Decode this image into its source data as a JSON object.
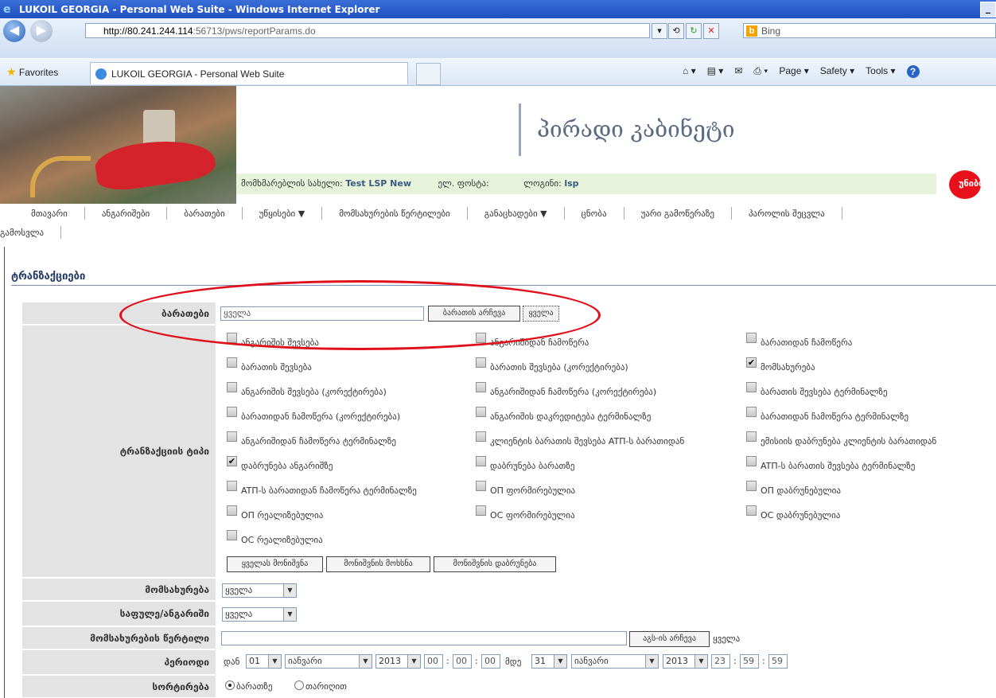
{
  "window": {
    "title": "LUKOIL GEORGIA - Personal Web Suite - Windows Internet Explorer",
    "minimize": "_"
  },
  "address": {
    "url_host": "http://80.241.244.114",
    "url_path": ":56713/pws/reportParams.do",
    "search_text": "Bing"
  },
  "favorites": {
    "label": "Favorites",
    "tab_title": "LUKOIL GEORGIA - Personal Web Suite"
  },
  "commands": {
    "page": "Page ▾",
    "safety": "Safety ▾",
    "tools": "Tools ▾",
    "help": "?"
  },
  "header": {
    "title": "პირადი კაბინეტი",
    "user_label": "მომხმარებლის სახელი:",
    "user_value": "Test LSP New",
    "email_label": "ელ. ფოსტა:",
    "login_label": "ლოგინი:",
    "login_value": "lsp",
    "brand": "უნიბრე"
  },
  "menu": {
    "row1": [
      "მთავარი",
      "ანგარიშები",
      "ბარათები",
      "უწყისები ▼",
      "მომსახურების წერტილები",
      "განაცხადები ▼",
      "ცნობა",
      "უარი გამოწერაზე",
      "პაროლის შეცვლა"
    ],
    "row2": [
      "გამოსვლა"
    ]
  },
  "section_title": "ტრანზაქციები",
  "cards": {
    "label": "ბარათები",
    "value": "ყველა",
    "choose_button": "ბარათის არჩევა",
    "all_button": "ყველა"
  },
  "tx_type": {
    "label": "ტრანზაქციის ტიპი",
    "col1": [
      {
        "label": "ანგარიშის შევსება",
        "checked": false
      },
      {
        "label": "ბარათის შევსება",
        "checked": false
      },
      {
        "label": "ანგარიშის შევსება (კორექტირება)",
        "checked": false
      },
      {
        "label": "ბარათიდან ჩამოწერა (კორექტირება)",
        "checked": false
      },
      {
        "label": "ანგარიშიდან ჩამოწერა ტერმინალზე",
        "checked": false
      },
      {
        "label": "დაბრუნება ანგარიშზე",
        "checked": true
      },
      {
        "label": "ATП-ს ბარათიდან ჩამოწერა ტერმინალზე",
        "checked": false
      },
      {
        "label": "ОП რეალიზებულია",
        "checked": false
      },
      {
        "label": "ОС რეალიზებულია",
        "checked": false
      }
    ],
    "col2": [
      {
        "label": "ანგარიშიდან ჩამოწერა",
        "checked": false
      },
      {
        "label": "ბარათის შევსება (კორექტირება)",
        "checked": false
      },
      {
        "label": "ანგარიშიდან ჩამოწერა (კორექტირება)",
        "checked": false
      },
      {
        "label": "ანგარიშის დაკრედიტება ტერმინალზე",
        "checked": false
      },
      {
        "label": "კლიენტის ბარათის შევსება ATП-ს ბარათიდან",
        "checked": false
      },
      {
        "label": "დაბრუნება ბარათზე",
        "checked": false
      },
      {
        "label": "ОП ფორმირებულია",
        "checked": false
      },
      {
        "label": "ОС ფორმირებულია",
        "checked": false
      }
    ],
    "col3": [
      {
        "label": "ბარათიდან ჩამოწერა",
        "checked": false
      },
      {
        "label": "მომსახურება",
        "checked": true
      },
      {
        "label": "ბარათის შევსება ტერმინალზე",
        "checked": false
      },
      {
        "label": "ბარათიდან ჩამოწერა ტერმინალზე",
        "checked": false
      },
      {
        "label": "ემისიის დაბრუნება კლიენტის ბარათიდან",
        "checked": false
      },
      {
        "label": "ATП-ს ბარათის შევსება ტერმინალზე",
        "checked": false
      },
      {
        "label": "ОП დაბრუნებულია",
        "checked": false
      },
      {
        "label": "ОС დაბრუნებულია",
        "checked": false
      }
    ],
    "buttons": [
      "ყველას მონიშვნა",
      "მონიშვნის მოხსნა",
      "მონიშვნის დაბრუნება"
    ]
  },
  "service": {
    "label": "მომსახურება",
    "value": "ყველა"
  },
  "account": {
    "label": "საფულე/ანგარიში",
    "value": "ყველა"
  },
  "point": {
    "label": "მომსახურების წერტილი",
    "value": "",
    "choose_button": "აგს-ის არჩევა",
    "all_text": "ყველა"
  },
  "period": {
    "label": "პერიოდი",
    "from_label": "დან",
    "from_day": "01",
    "from_month": "იანვარი",
    "from_year": "2013",
    "from_h": "00",
    "from_m": "00",
    "from_s": "00",
    "to_label": "მდე",
    "to_day": "31",
    "to_month": "იანვარი",
    "to_year": "2013",
    "to_h": "23",
    "to_m": "59",
    "to_s": "59",
    "colon": ":"
  },
  "sort": {
    "label": "სორტირება",
    "opt1": "ბარათზე",
    "opt2": "თარიღით",
    "selected": "ბარათზე"
  },
  "colors": {
    "highlight_ellipse": "#e0101a",
    "label_bg": "#e3e3e3",
    "title_color": "#223a66"
  }
}
